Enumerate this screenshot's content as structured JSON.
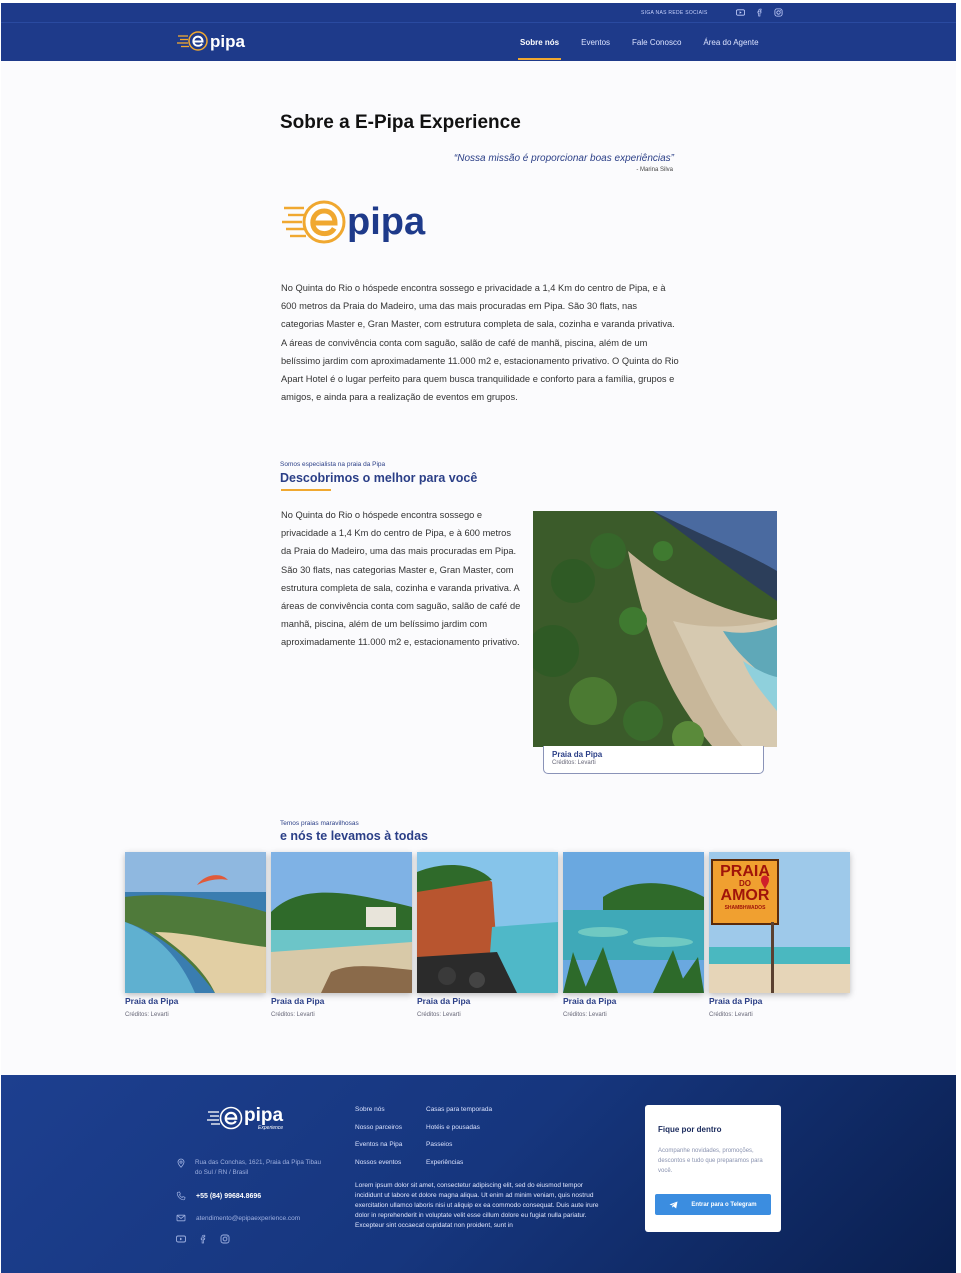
{
  "brand": {
    "name": "pipa",
    "sub": "Experience"
  },
  "topbar": {
    "social_label": "SIGA NAS REDE SOCIAIS"
  },
  "nav": {
    "items": [
      {
        "label": "Sobre nós",
        "active": true
      },
      {
        "label": "Eventos",
        "active": false
      },
      {
        "label": "Fale Conosco",
        "active": false
      },
      {
        "label": "Área do Agente",
        "active": false
      }
    ]
  },
  "about": {
    "title": "Sobre a E-Pipa Experience",
    "quote": "“Nossa missão é proporcionar boas experiências”",
    "quote_author": "- Marina Silva",
    "paragraph": "No Quinta do Rio o hóspede encontra sossego e privacidade a 1,4 Km do centro de Pipa, e à 600 metros da Praia do Madeiro, uma das mais procuradas em Pipa. São 30 flats, nas categorias Master e, Gran Master, com estrutura completa de sala, cozinha e varanda privativa. A áreas de convivência conta com saguão, salão de café de manhã, piscina, além de um belíssimo jardim com aproximadamente 11.000 m2 e, estacionamento privativo. O Quinta do Rio Apart Hotel é o lugar perfeito para quem busca tranquilidade e conforto para a família, grupos e amigos, e ainda para a realização de eventos em grupos."
  },
  "discover": {
    "kicker": "Somos especialista na praia da Pipa",
    "title": "Descobrimos o melhor para você",
    "paragraph": "No Quinta do Rio o hóspede encontra sossego e privacidade a 1,4 Km do centro de Pipa, e à 600 metros da Praia do Madeiro, uma das mais procuradas em Pipa. São 30 flats, nas categorias Master e, Gran Master, com estrutura completa de sala, cozinha e varanda privativa. A áreas de convivência conta com saguão, salão de café de manhã, piscina, além de um belíssimo jardim com aproximadamente 11.000 m2 e, estacionamento privativo.",
    "image_title": "Praia da Pipa",
    "image_credit": "Créditos: Levarti"
  },
  "beaches": {
    "kicker": "Temos praias maravilhosas",
    "title": "e nós te levamos à todas",
    "cards": [
      {
        "title": "Praia da Pipa",
        "credit": "Créditos: Levarti"
      },
      {
        "title": "Praia da Pipa",
        "credit": "Créditos: Levarti"
      },
      {
        "title": "Praia da Pipa",
        "credit": "Créditos: Levarti"
      },
      {
        "title": "Praia da Pipa",
        "credit": "Créditos: Levarti"
      },
      {
        "title": "Praia da Pipa",
        "credit": "Créditos: Levarti",
        "sign_lines": [
          "PRAIA",
          "DO",
          "AMOR"
        ],
        "sign_small": "SHAMBHWADOS"
      }
    ]
  },
  "footer": {
    "address": "Rua das Conchas, 1621, Praia da Pipa Tibau do Sul / RN / Brasil",
    "phone": "+55 (84) 99684.8696",
    "email": "atendimento@epipaexperience.com",
    "links_col1": [
      "Sobre nós",
      "Nosso parceiros",
      "Eventos na Pipa",
      "Nossos eventos"
    ],
    "links_col2": [
      "Casas para temporada",
      "Hotéis e pousadas",
      "Passeios",
      "Experiências"
    ],
    "lorem": "Lorem ipsum dolor sit amet, consectetur adipiscing elit, sed do eiusmod tempor incididunt ut labore et dolore magna aliqua. Ut enim ad minim veniam, quis nostrud exercitation ullamco laboris nisi ut aliquip ex ea commodo consequat. Duis aute irure dolor in reprehenderit in voluptate velit esse cillum dolore eu fugiat nulla pariatur. Excepteur sint occaecat cupidatat non proident, sunt in",
    "newsletter": {
      "title": "Fique por dentro",
      "text": "Acompanhe novidades, promoções, descontos e tudo que preparamos para você.",
      "button": "Entrar para o Telegram"
    }
  },
  "colors": {
    "primary": "#1e3a8a",
    "accent": "#f0a830",
    "telegram": "#3b8de0"
  }
}
